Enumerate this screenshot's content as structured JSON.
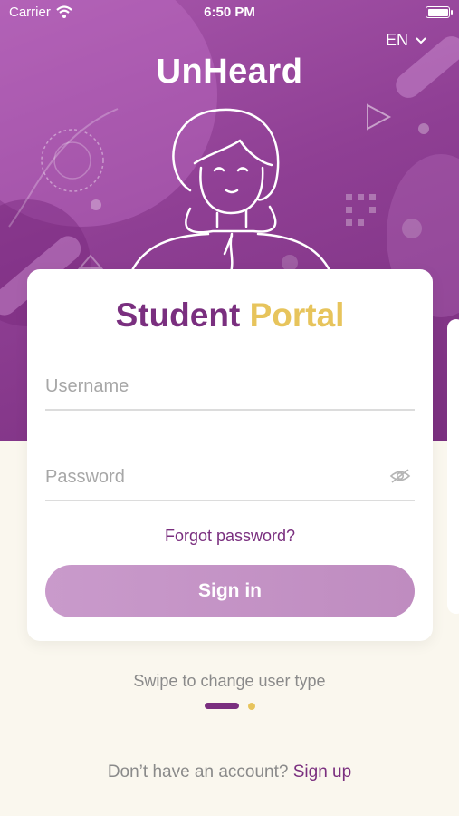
{
  "status_bar": {
    "carrier": "Carrier",
    "time": "6:50 PM"
  },
  "language": {
    "selected": "EN"
  },
  "brand": {
    "logo_text": "UnHeard"
  },
  "portal": {
    "title_part1": "Student",
    "title_part2": "Portal"
  },
  "form": {
    "username_placeholder": "Username",
    "username_value": "",
    "password_placeholder": "Password",
    "password_value": "",
    "forgot_label": "Forgot password?",
    "signin_label": "Sign in"
  },
  "pager": {
    "hint": "Swipe to change user type",
    "page_count": 2,
    "active_index": 0
  },
  "footer": {
    "prompt": "Don’t have an account?",
    "signup_label": "Sign up"
  },
  "colors": {
    "brand_purple": "#7a2f7f",
    "accent_gold": "#e7c45c",
    "background": "#faf7ee"
  }
}
